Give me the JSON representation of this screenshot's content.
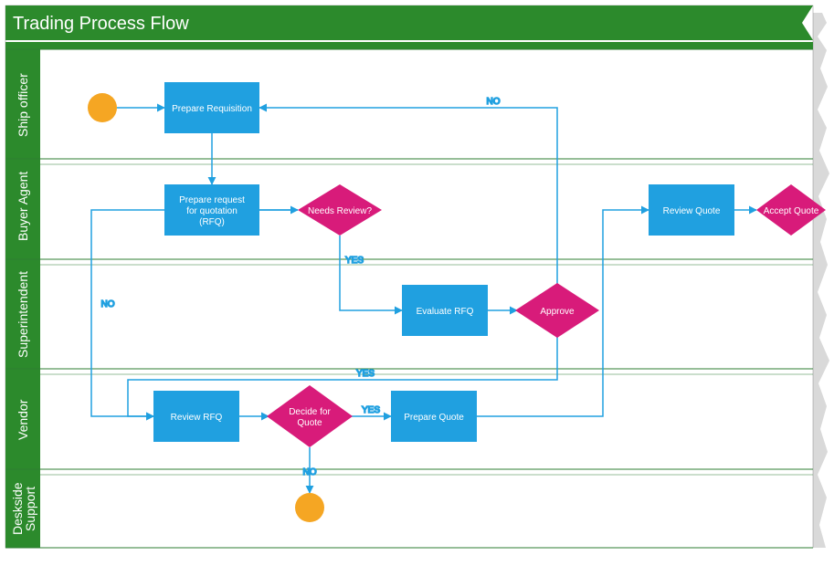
{
  "colors": {
    "green": "#2c8a2c",
    "greenDark": "#2e7d32",
    "blue": "#20a0e0",
    "magenta": "#d81b7a",
    "orange": "#f5a623",
    "edge": "#20a0e0",
    "shadow": "#bfbfbf"
  },
  "title": "Trading Process Flow",
  "lanes": [
    {
      "id": "ship-officer",
      "label": "Ship officer"
    },
    {
      "id": "buyer-agent",
      "label": "Buyer Agent"
    },
    {
      "id": "superintendent",
      "label": "Superintendent"
    },
    {
      "id": "vendor",
      "label": "Vendor"
    },
    {
      "id": "deskside-support",
      "label": "Deskside\nSupport"
    }
  ],
  "nodes": {
    "start": {
      "type": "start"
    },
    "prepare_requisition": {
      "type": "process",
      "label": "Prepare Requisition"
    },
    "prepare_rfq": {
      "type": "process",
      "label": "Prepare request\nfor quotation\n(RFQ)"
    },
    "needs_review": {
      "type": "decision",
      "label": "Needs Review?"
    },
    "evaluate_rfq": {
      "type": "process",
      "label": "Evaluate RFQ"
    },
    "approve": {
      "type": "decision",
      "label": "Approve"
    },
    "review_rfq": {
      "type": "process",
      "label": "Review RFQ"
    },
    "decide_for_quote": {
      "type": "decision",
      "label": "Decide for\nQuote"
    },
    "prepare_quote": {
      "type": "process",
      "label": "Prepare Quote"
    },
    "review_quote": {
      "type": "process",
      "label": "Review Quote"
    },
    "accept_quote": {
      "type": "decision",
      "label": "Accept Quote"
    },
    "end": {
      "type": "end"
    }
  },
  "edgeLabels": {
    "no1": "NO",
    "yes1": "YES",
    "no2": "NO",
    "yes2": "YES",
    "yes3": "YES",
    "no3": "NO"
  }
}
